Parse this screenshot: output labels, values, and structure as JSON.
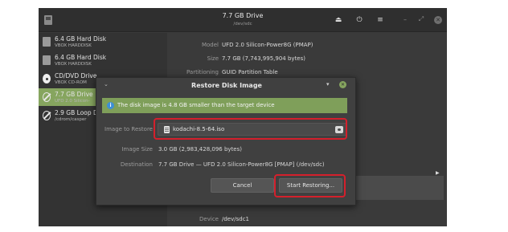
{
  "window": {
    "title": "7.7 GB Drive",
    "subtitle": "/dev/sdc",
    "icons": [
      "eject-icon",
      "power-icon",
      "menu-icon",
      "minimize-icon",
      "maximize-icon",
      "close-icon"
    ]
  },
  "sidebar": {
    "items": [
      {
        "name": "6.4 GB Hard Disk",
        "sub": "VBOX HARDDISK",
        "icon": "hard-disk-icon"
      },
      {
        "name": "6.4 GB Hard Disk",
        "sub": "VBOX HARDDISK",
        "icon": "hard-disk-icon"
      },
      {
        "name": "CD/DVD Drive",
        "sub": "VBOX CD-ROM",
        "icon": "optical-disc-icon"
      },
      {
        "name": "7.7 GB Drive",
        "sub": "UFD 2.0 Silicon-",
        "icon": "usb-drive-icon",
        "selected": true
      },
      {
        "name": "2.9 GB Loop D",
        "sub": "/cdrom/casper",
        "icon": "loop-device-icon"
      }
    ]
  },
  "main": {
    "model_label": "Model",
    "model_value": "UFD 2.0 Silicon-Power8G (PMAP)",
    "size_label": "Size",
    "size_value": "7.7 GB (7,743,995,904 bytes)",
    "partitioning_label": "Partitioning",
    "partitioning_value": "GUID Partition Table",
    "device_label": "Device",
    "device_value": "/dev/sdc1"
  },
  "dialog": {
    "title": "Restore Disk Image",
    "info_message": "The disk image is 4.8 GB smaller than the target device",
    "image_to_restore_label": "Image to Restore",
    "image_file": "kodachi-8.5-64.iso",
    "image_size_label": "Image Size",
    "image_size_value": "3.0 GB (2,983,428,096 bytes)",
    "destination_label": "Destination",
    "destination_value": "7.7 GB Drive — UFD 2.0 Silicon-Power8G [PMAP] (/dev/sdc)",
    "cancel_label": "Cancel",
    "start_label": "Start Restoring..."
  },
  "colors": {
    "accent_green": "#86a55f",
    "info_bar": "#7f9f5a",
    "highlight_red": "#d4202c"
  }
}
